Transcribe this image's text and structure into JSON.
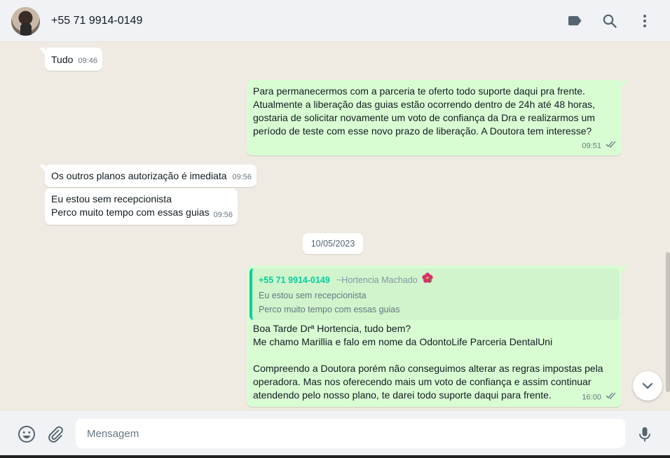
{
  "header": {
    "contact_name": "+55 71 9914-0149",
    "icons": [
      "label-icon",
      "search-icon",
      "menu-dots-icon"
    ]
  },
  "messages": [
    {
      "direction": "in",
      "text": "Tudo",
      "time": "09:46"
    },
    {
      "direction": "out",
      "text": "Para permanecermos com a parceria te oferto todo suporte daqui pra frente.\nAtualmente a liberação das guias estão ocorrendo dentro de 24h até 48 horas,\ngostaria de solicitar novamente um voto de confiança da Dra e realizarmos um\nperíodo de teste com esse novo prazo de liberação. A Doutora tem interesse?",
      "time": "09:51",
      "status": "read"
    },
    {
      "direction": "in",
      "text": "Os outros planos autorização é imediata",
      "time": "09:56"
    },
    {
      "direction": "in",
      "text": "Eu estou sem recepcionista\nPerco muito tempo com essas guias",
      "time": "09:56"
    },
    {
      "direction": "out",
      "text": "Boa Tarde Drª Hortencia, tudo bem?\nMe chamo Marillia e falo em nome da OdontoLife Parceria DentalUni\n\nCompreendo a Doutora porém não conseguimos alterar as regras impostas pela\noperadora. Mas nos oferecendo mais um voto de confiança e assim continuar\natendendo pelo nosso plano, te darei todo suporte daqui para frente.",
      "time": "16:00",
      "status": "read",
      "quoted": {
        "sender": "+55 71 9914-0149",
        "alias": "~Hortencia Machado",
        "text": "Eu estou sem recepcionista\nPerco muito tempo com essas guias"
      }
    }
  ],
  "date_divider": "10/05/2023",
  "footer": {
    "placeholder": "Mensagem",
    "icons": [
      "emoji-icon",
      "attach-icon",
      "mic-icon"
    ]
  },
  "colors": {
    "chat_bg": "#efeae2",
    "outgoing_bubble": "#d9fdd3",
    "incoming_bubble": "#ffffff",
    "quote_accent": "#06cf9c",
    "read_ticks": "#667781"
  }
}
